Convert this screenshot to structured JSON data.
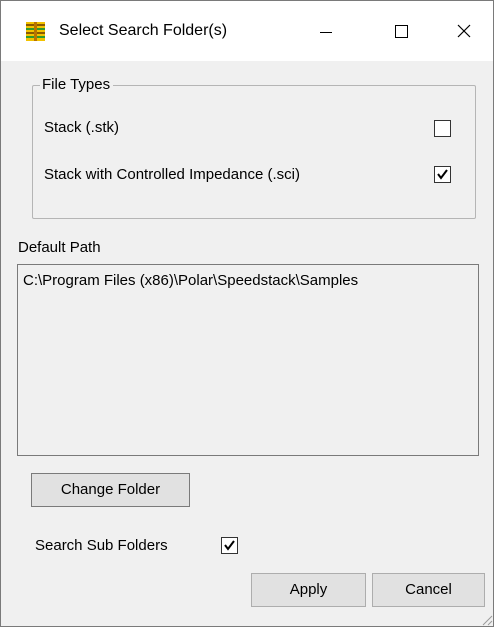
{
  "window": {
    "title": "Select Search Folder(s)",
    "controls": {
      "minimize_icon": "minimize-icon",
      "maximize_icon": "maximize-icon",
      "close_icon": "close-icon"
    }
  },
  "file_types": {
    "legend": "File Types",
    "items": [
      {
        "label": "Stack (.stk)",
        "checked": false
      },
      {
        "label": "Stack with Controlled Impedance (.sci)",
        "checked": true
      }
    ]
  },
  "default_path": {
    "label": "Default Path",
    "value": "C:\\Program Files (x86)\\Polar\\Speedstack\\Samples"
  },
  "buttons": {
    "change_folder": "Change Folder",
    "apply": "Apply",
    "cancel": "Cancel"
  },
  "search_sub_folders": {
    "label": "Search Sub Folders",
    "checked": true
  },
  "colors": {
    "dialog_background": "#f0f0f0",
    "titlebar_background": "#ffffff",
    "button_background": "#e1e1e1"
  }
}
